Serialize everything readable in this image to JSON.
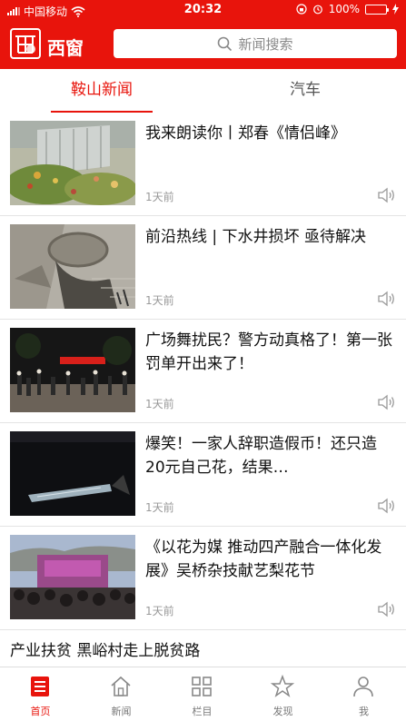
{
  "status_bar": {
    "carrier": "中国移动",
    "time": "20:32",
    "battery": "100%"
  },
  "header": {
    "app_title": "西窗",
    "search_placeholder": "新闻搜索"
  },
  "tabs": [
    {
      "label": "鞍山新闻",
      "active": true
    },
    {
      "label": "汽车",
      "active": false
    }
  ],
  "news": [
    {
      "title": "我来朗读你丨郑春《情侣峰》",
      "time": "1天前",
      "thumb": "painting-garden"
    },
    {
      "title": "前沿热线 | 下水井损坏 亟待解决",
      "time": "1天前",
      "thumb": "broken-manhole"
    },
    {
      "title": "广场舞扰民？警方动真格了！第一张罚单开出来了！",
      "time": "1天前",
      "thumb": "night-square-crowd"
    },
    {
      "title": "爆笑！一家人辞职造假币！还只造20元自己花，结果…",
      "time": "1天前",
      "thumb": "dark-money-scene"
    },
    {
      "title": "《以花为媒 推动四产融合一体化发展》吴桥杂技献艺梨花节",
      "time": "1天前",
      "thumb": "stage-performance"
    }
  ],
  "text_only_item": {
    "title": "产业扶贫 黑峪村走上脱贫路"
  },
  "bottom_nav": [
    {
      "label": "首页",
      "icon": "home-list-icon",
      "active": true
    },
    {
      "label": "新闻",
      "icon": "house-icon",
      "active": false
    },
    {
      "label": "栏目",
      "icon": "grid-icon",
      "active": false
    },
    {
      "label": "发现",
      "icon": "star-icon",
      "active": false
    },
    {
      "label": "我",
      "icon": "person-icon",
      "active": false
    }
  ],
  "colors": {
    "brand": "#e8140c",
    "battery": "#4cd964"
  }
}
